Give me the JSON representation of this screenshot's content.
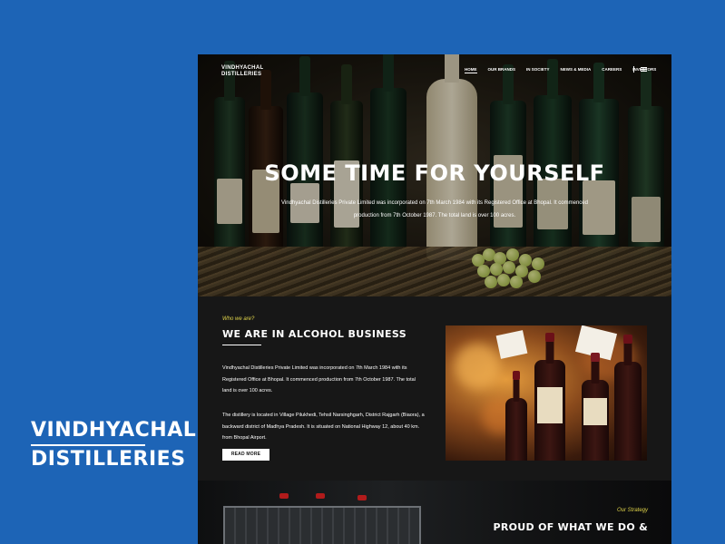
{
  "brand": {
    "line1": "VINDHYACHAL",
    "line2": "DISTILLERIES"
  },
  "site": {
    "logo_line1": "VINDHYACHAL",
    "logo_line2": "DISTILLERIES",
    "nav": [
      "HOME",
      "OUR BRANDS",
      "IN SOCIETY",
      "NEWS & MEDIA",
      "CAREERS",
      "INVESTORS"
    ],
    "active_nav": "HOME"
  },
  "hero": {
    "title": "SOME TIME FOR YOURSELF",
    "description": "Vindhyachal Distilleries Private Limited was incorporated on 7th March 1984 with its Registered Office at Bhopal. It commenced production from 7th October 1987. The total land is over 100 acres."
  },
  "about": {
    "eyebrow": "Who we are?",
    "title": "WE ARE IN ALCOHOL BUSINESS",
    "paragraph1": "Vindhyachal Distilleries Private Limited was incorporated on 7th March 1984 with its Registered Office at Bhopal. It commenced production from 7th October 1987. The total land is over 100 acres.",
    "paragraph2": "The distillery is located in Village Pilukhedi, Tehsil Narsinghgarh, District Rajgarh (Biaora), a backward district of Madhya Pradesh. It is situated on National Highway 12, about 40 km. from Bhopal Airport.",
    "button": "READ MORE"
  },
  "strategy": {
    "eyebrow": "Our Strategy",
    "title": "PROUD OF WHAT WE DO &"
  },
  "colors": {
    "background": "#1d64b6",
    "page": "#161616",
    "accent": "#e0d44a"
  }
}
